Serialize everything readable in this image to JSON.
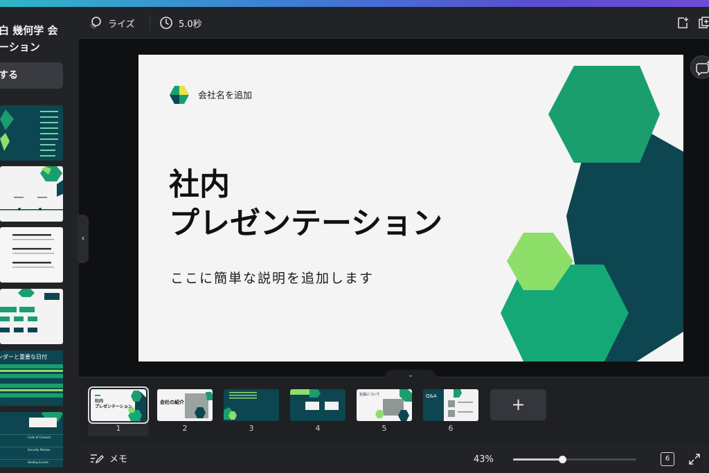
{
  "app": {
    "accent_gradient": [
      "#2fb6c8",
      "#3d7fd6",
      "#6d4bd6"
    ]
  },
  "sidebar": {
    "title_line1": "白 幾何学 会",
    "title_line2": "ーション",
    "button_label": "する",
    "thumb5_text": "ンダーと重要な日付",
    "thumb6_rows": [
      "Code of Conduct",
      "Security Policies",
      "Holiday Events"
    ]
  },
  "toolbar": {
    "animation_label": "ライズ",
    "animation_icon": "rise-animation-icon",
    "duration_label": "5.0秒",
    "duration_icon": "clock-icon",
    "add_page_icon": "add-page-icon",
    "duplicate_icon": "duplicate-page-icon"
  },
  "slide": {
    "company_name": "会社名を追加",
    "title_line1": "社内",
    "title_line2": "プレゼンテーション",
    "subtitle": "ここに簡単な説明を追加します",
    "colors": {
      "green": "#1a9e6e",
      "teal": "#0d4650",
      "lime": "#8ede6a",
      "mid": "#14a877"
    }
  },
  "filmstrip": {
    "pages": [
      {
        "num": "1",
        "text": "社内\nプレゼンテーション",
        "selected": true
      },
      {
        "num": "2",
        "text": "会社の紹介"
      },
      {
        "num": "3",
        "text": ""
      },
      {
        "num": "4",
        "text": ""
      },
      {
        "num": "5",
        "text": "社員について"
      },
      {
        "num": "6",
        "text": "Q&A"
      }
    ],
    "add_label": "+"
  },
  "bottombar": {
    "memo_label": "メモ",
    "memo_icon": "notes-pen-icon",
    "zoom_label": "43%",
    "zoom_fraction": 0.4,
    "page_count": "6",
    "expand_icon": "fullscreen-icon"
  }
}
